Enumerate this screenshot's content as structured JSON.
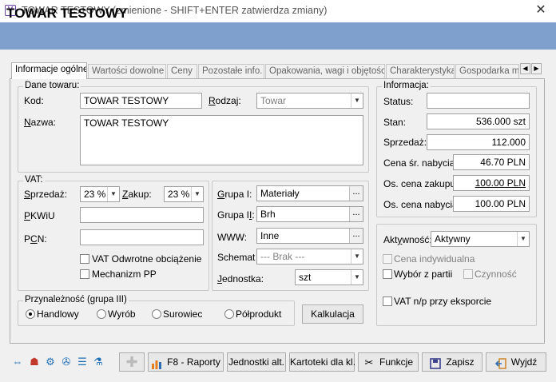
{
  "window": {
    "title": "TOWAR TESTOWY (zmienione - SHIFT+ENTER zatwierdza zmiany)",
    "app_icon": "V",
    "close_glyph": "✕"
  },
  "header": {
    "title": "TOWAR TESTOWY"
  },
  "tabs": [
    "Informacje ogólne",
    "Wartości dowolne",
    "Ceny",
    "Pozostałe info.",
    "Opakowania, wagi i objętości",
    "Charakterystyka",
    "Gospodarka ma"
  ],
  "dane_towaru": {
    "title": "Dane towaru:",
    "kod_label": "Kod:",
    "kod_value": "TOWAR TESTOWY",
    "rodzaj_label": "Rodzaj:",
    "rodzaj_value": "Towar",
    "nazwa_label": "Nazwa:",
    "nazwa_value": "TOWAR TESTOWY"
  },
  "vat": {
    "title": "VAT:",
    "sprzedaz_label": "Sprzedaż:",
    "sprzedaz_value": "23 %",
    "zakup_label": "Zakup:",
    "zakup_value": "23 %",
    "pkwiu_label": "PKWiU",
    "pkwiu_value": "",
    "pcn_label": "PCN:",
    "pcn_value": "",
    "odwrotne_label": "VAT Odwrotne obciążenie",
    "mechanizm_label": "Mechanizm PP"
  },
  "grupy": {
    "grupa1_label": "Grupa I:",
    "grupa1_value": "Materiały",
    "grupa2_label": "Grupa II:",
    "grupa2_value": "Brh",
    "www_label": "WWW:",
    "www_value": "Inne",
    "schemat_label": "Schemat",
    "schemat_value": "--- Brak ---",
    "jednostka_label": "Jednostka:",
    "jednostka_value": "szt",
    "ellipsis": "..."
  },
  "informacja": {
    "title": "Informacja:",
    "status_label": "Status:",
    "status_value": "",
    "stan_label": "Stan:",
    "stan_value": "536.000 szt",
    "sprzedaz_label": "Sprzedaż:",
    "sprzedaz_value": "112.000",
    "cena_sr_label": "Cena śr. nabycia:",
    "cena_sr_value": "46.70 PLN",
    "os_zakupu_label": "Os. cena zakupu:",
    "os_zakupu_value": "100.00 PLN",
    "os_nabycia_label": "Os. cena nabycia:",
    "os_nabycia_value": "100.00 PLN"
  },
  "aktywnosc": {
    "label": "Aktywność:",
    "value": "Aktywny",
    "cena_ind_label": "Cena indywidualna",
    "wybor_label": "Wybór z partii",
    "czynnosc_label": "Czynność",
    "vat_np_label": "VAT n/p przy eksporcie"
  },
  "przynaleznosc": {
    "title": "Przynależność (grupa III)",
    "options": [
      "Handlowy",
      "Wyrób",
      "Surowiec",
      "Półprodukt"
    ],
    "selected": "Handlowy"
  },
  "buttons": {
    "kalkulacja": "Kalkulacja",
    "raporty": "F8 - Raporty",
    "jednostki": "Jednostki alt.",
    "kartoteki": "Kartoteki dla kl.",
    "funkcje": "Funkcje",
    "zapisz": "Zapisz",
    "wyjdz": "Wyjdź"
  },
  "colors": {
    "header_band": "#7f9fcd",
    "toolbar_icon": "#1f6fb5"
  }
}
